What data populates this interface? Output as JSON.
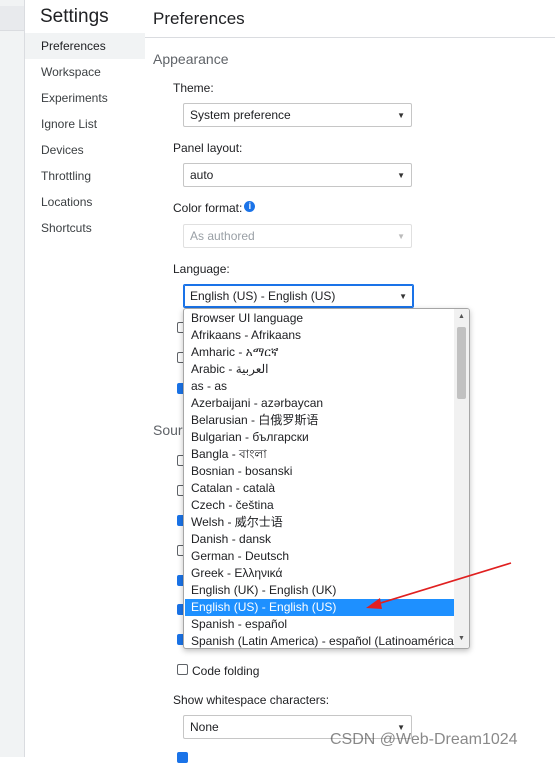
{
  "sidebar": {
    "title": "Settings",
    "items": [
      {
        "label": "Preferences"
      },
      {
        "label": "Workspace"
      },
      {
        "label": "Experiments"
      },
      {
        "label": "Ignore List"
      },
      {
        "label": "Devices"
      },
      {
        "label": "Throttling"
      },
      {
        "label": "Locations"
      },
      {
        "label": "Shortcuts"
      }
    ]
  },
  "main": {
    "title": "Preferences",
    "appearance": {
      "section_title": "Appearance",
      "theme_label": "Theme:",
      "theme_value": "System preference",
      "panel_layout_label": "Panel layout:",
      "panel_layout_value": "auto",
      "color_format_label": "Color format:",
      "color_format_value": "As authored",
      "language_label": "Language:",
      "language_value": "English (US) - English (US)"
    },
    "sources_partial": "Sour",
    "code_folding_label": "Code folding",
    "whitespace_label": "Show whitespace characters:",
    "whitespace_value": "None"
  },
  "language_dropdown": {
    "options": [
      "Browser UI language",
      "Afrikaans - Afrikaans",
      "Amharic - አማርኛ",
      "Arabic - العربية",
      "as - as",
      "Azerbaijani - azərbaycan",
      "Belarusian - 白俄罗斯语",
      "Bulgarian - български",
      "Bangla - বাংলা",
      "Bosnian - bosanski",
      "Catalan - català",
      "Czech - čeština",
      "Welsh - 威尔士语",
      "Danish - dansk",
      "German - Deutsch",
      "Greek - Ελληνικά",
      "English (UK) - English (UK)",
      "English (US) - English (US)",
      "Spanish - español",
      "Spanish (Latin America) - español (Latinoamérica)"
    ],
    "selected": "English (US) - English (US)"
  },
  "watermark": "CSDN @Web-Dream1024",
  "colors": {
    "accent": "#1a73e8",
    "selected_option": "#1e90ff",
    "annotation_arrow": "#e02020"
  },
  "icons": {
    "info": "info-icon",
    "dropdown_arrow": "chevron-down-icon"
  }
}
